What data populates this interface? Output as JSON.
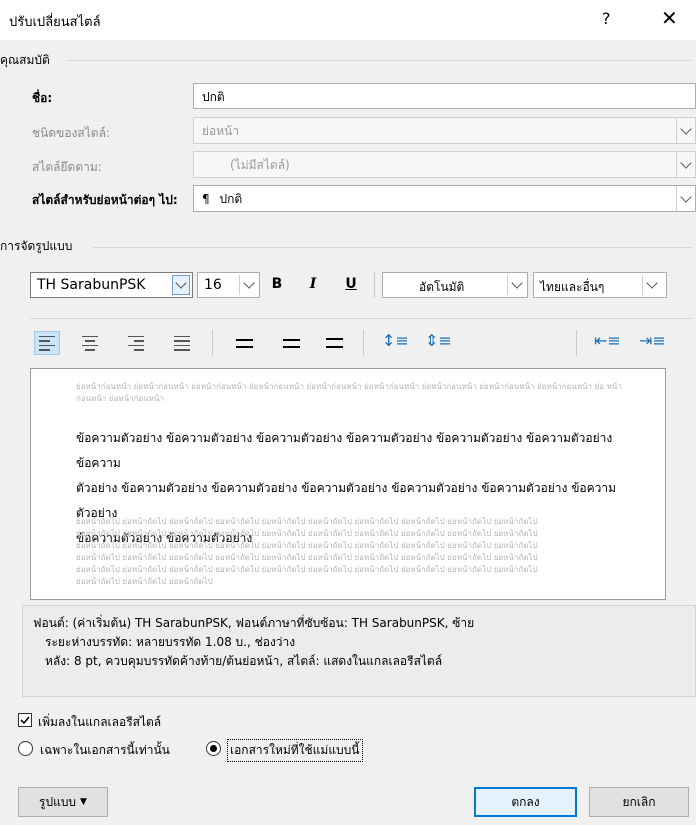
{
  "window": {
    "title": "ปรับเปลี่ยนสไตล์",
    "help": "?",
    "close": "✕"
  },
  "properties": {
    "group_label": "คุณสมบัติ",
    "name_label": "ชื่อ:",
    "name_value": "ปกติ",
    "style_type_label": "ชนิดของสไตล์:",
    "style_type_value": "ย่อหน้า",
    "based_on_label": "สไตล์ยึดตาม:",
    "based_on_value": "(ไม่มีสไตล์)",
    "following_label": "สไตล์สำหรับย่อหน้าต่อๆ ไป:",
    "following_value": "ปกติ",
    "following_icon": "¶"
  },
  "formatting": {
    "group_label": "การจัดรูปแบบ",
    "font": "TH SarabunPSK",
    "size": "16",
    "bold": "B",
    "italic": "I",
    "underline": "U",
    "color": "อัตโนมัติ",
    "script": "ไทยและอื่นๆ"
  },
  "preview": {
    "prev_para": "ย่อหน้าก่อนหน้า ย่อหน้าก่อนหน้า ย่อหน้าก่อนหน้า ย่อหน้าก่อนหน้า ย่อหน้าก่อนหน้า ย่อหน้าก่อนหน้า ย่อหน้าก่อนหน้า ย่อหน้าก่อนหน้า ย่อหน้าก่อนหน้า ย่อ หน้าก่อนหน้า ย่อหน้าก่อนหน้า",
    "sample_lines": [
      "ข้อความตัวอย่าง ข้อความตัวอย่าง ข้อความตัวอย่าง ข้อความตัวอย่าง ข้อความตัวอย่าง ข้อความตัวอย่าง ข้อความ",
      "ตัวอย่าง ข้อความตัวอย่าง ข้อความตัวอย่าง ข้อความตัวอย่าง ข้อความตัวอย่าง ข้อความตัวอย่าง ข้อความตัวอย่าง",
      "ข้อความตัวอย่าง ข้อความตัวอย่าง"
    ],
    "next_lines": [
      "ย่อหน้าถัดไป ย่อหน้าถัดไป ย่อหน้าถัดไป ย่อหน้าถัดไป ย่อหน้าถัดไป ย่อหน้าถัดไป ย่อหน้าถัดไป ย่อหน้าถัดไป ย่อหน้าถัดไป ย่อหน้าถัดไป",
      "ย่อหน้าถัดไป ย่อหน้าถัดไป ย่อหน้าถัดไป ย่อหน้าถัดไป ย่อหน้าถัดไป ย่อหน้าถัดไป ย่อหน้าถัดไป ย่อหน้าถัดไป ย่อหน้าถัดไป ย่อหน้าถัดไป",
      "ย่อหน้าถัดไป ย่อหน้าถัดไป ย่อหน้าถัดไป ย่อหน้าถัดไป ย่อหน้าถัดไป ย่อหน้าถัดไป ย่อหน้าถัดไป ย่อหน้าถัดไป ย่อหน้าถัดไป ย่อหน้าถัดไป",
      "ย่อหน้าถัดไป ย่อหน้าถัดไป ย่อหน้าถัดไป ย่อหน้าถัดไป ย่อหน้าถัดไป ย่อหน้าถัดไป ย่อหน้าถัดไป ย่อหน้าถัดไป ย่อหน้าถัดไป ย่อหน้าถัดไป",
      "ย่อหน้าถัดไป ย่อหน้าถัดไป ย่อหน้าถัดไป ย่อหน้าถัดไป ย่อหน้าถัดไป ย่อหน้าถัดไป ย่อหน้าถัดไป ย่อหน้าถัดไป ย่อหน้าถัดไป ย่อหน้าถัดไป",
      "ย่อหน้าถัดไป ย่อหน้าถัดไป ย่อหน้าถัดไป"
    ]
  },
  "description": {
    "line1": "ฟอนต์: (ค่าเริ่มต้น) TH SarabunPSK, ฟอนต์ภาษาที่ซับซ้อน: TH SarabunPSK, ซ้าย",
    "line2": "ระยะห่างบรรทัด:  หลายบรรทัด 1.08 บ., ช่องว่าง",
    "line3": "หลัง:  8 pt, ควบคุมบรรทัดค้างท้าย/ต้นย่อหน้า, สไตล์: แสดงในแกลเลอรีสไตล์"
  },
  "options": {
    "add_gallery": "เพิ่มลงในแกลเลอรีสไตล์",
    "only_doc": "เฉพาะในเอกสารนี้เท่านั้น",
    "new_docs": "เอกสารใหม่ที่ใช้แม่แบบนี้"
  },
  "buttons": {
    "format": "รูปแบบ",
    "ok": "ตกลง",
    "cancel": "ยกเลิก"
  },
  "colors": {
    "accent": "#0078d7",
    "selected_btn": "#cce4f7"
  }
}
